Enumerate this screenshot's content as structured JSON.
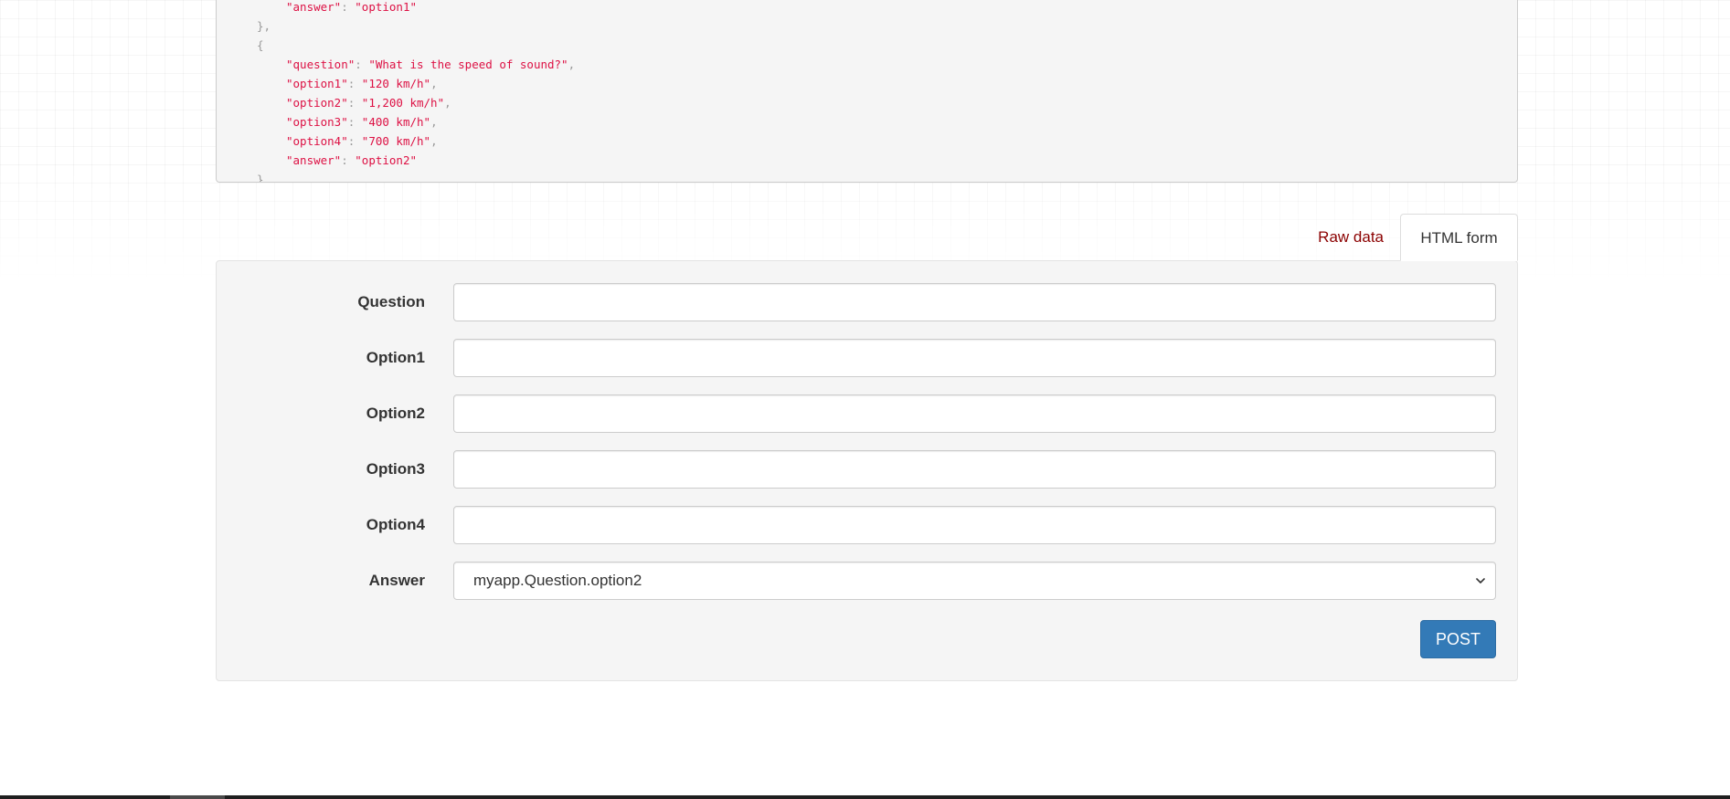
{
  "response": {
    "lines": [
      {
        "indent": "ind2",
        "key": "\"answer\"",
        "sep": ": ",
        "value": "\"option1\"",
        "trail": ""
      },
      {
        "indent": "ind1",
        "key": "",
        "sep": "",
        "value": "",
        "trail": "},"
      },
      {
        "indent": "ind1",
        "key": "",
        "sep": "",
        "value": "",
        "trail": "{"
      },
      {
        "indent": "ind2",
        "key": "\"question\"",
        "sep": ": ",
        "value": "\"What is the speed of sound?\"",
        "trail": ","
      },
      {
        "indent": "ind2",
        "key": "\"option1\"",
        "sep": ": ",
        "value": "\"120 km/h\"",
        "trail": ","
      },
      {
        "indent": "ind2",
        "key": "\"option2\"",
        "sep": ": ",
        "value": "\"1,200 km/h\"",
        "trail": ","
      },
      {
        "indent": "ind2",
        "key": "\"option3\"",
        "sep": ": ",
        "value": "\"400 km/h\"",
        "trail": ","
      },
      {
        "indent": "ind2",
        "key": "\"option4\"",
        "sep": ": ",
        "value": "\"700 km/h\"",
        "trail": ","
      },
      {
        "indent": "ind2",
        "key": "\"answer\"",
        "sep": ": ",
        "value": "\"option2\"",
        "trail": ""
      },
      {
        "indent": "ind1",
        "key": "",
        "sep": "",
        "value": "",
        "trail": "}"
      },
      {
        "indent": "",
        "key": "",
        "sep": "",
        "value": "",
        "trail": "]"
      }
    ]
  },
  "tabs": {
    "raw_data": "Raw data",
    "html_form": "HTML form"
  },
  "form": {
    "question": {
      "label": "Question",
      "value": ""
    },
    "option1": {
      "label": "Option1",
      "value": ""
    },
    "option2": {
      "label": "Option2",
      "value": ""
    },
    "option3": {
      "label": "Option3",
      "value": ""
    },
    "option4": {
      "label": "Option4",
      "value": ""
    },
    "answer": {
      "label": "Answer",
      "selected": "myapp.Question.option2"
    },
    "submit_label": "POST"
  },
  "icons": {
    "select": "chevron-down-icon"
  },
  "colors": {
    "string": "#dd1144",
    "punctuation": "#999999",
    "tab_active_link": "#8b0000",
    "primary_button": "#337ab7"
  }
}
